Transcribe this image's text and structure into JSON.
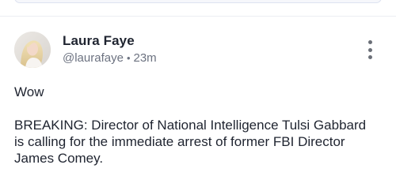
{
  "post": {
    "author": {
      "name": "Laura Faye",
      "handle": "@laurafaye",
      "timestamp": "23m"
    },
    "content": {
      "line_1": "Wow",
      "line_2": "BREAKING: Director of National Intelligence Tulsi Gabbard is calling for the immediate arrest of former FBI Director James Comey."
    },
    "separator": "•",
    "more_menu_icon": "vertical-ellipsis-icon"
  },
  "colors": {
    "text": "#1f2430",
    "muted": "#6c7280",
    "divider": "#eceef2"
  }
}
